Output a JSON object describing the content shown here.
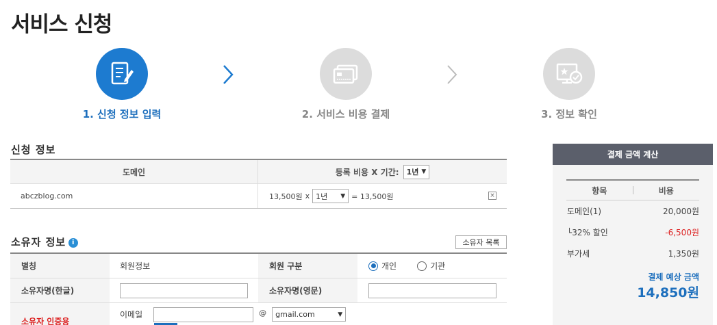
{
  "page": {
    "title": "서비스 신청"
  },
  "steps": [
    {
      "label": "1. 신청 정보 입력",
      "icon": "form-edit-icon",
      "active": true
    },
    {
      "label": "2. 서비스 비용 결제",
      "icon": "credit-card-icon",
      "active": false
    },
    {
      "label": "3. 정보 확인",
      "icon": "monitor-check-icon",
      "active": false
    }
  ],
  "application": {
    "section_title": "신청 정보",
    "col_domain": "도메인",
    "col_fee_prefix": "등록 비용 X 기간:",
    "period_select": "1년",
    "row": {
      "domain": "abczblog.com",
      "price": "13,500원",
      "times": "x",
      "period": "1년",
      "result": "= 13,500원",
      "remove": "×"
    }
  },
  "owner": {
    "section_title": "소유자 정보",
    "info_icon": "i",
    "list_button": "소유자 목록",
    "nickname_label": "별칭",
    "nickname_value": "회원정보",
    "member_type_label": "회원 구분",
    "member_type_options": [
      "개인",
      "기관"
    ],
    "member_type_selected": "개인",
    "name_kr_label": "소유자명(한글)",
    "name_en_label": "소유자명(영문)",
    "cert_label": "소유자 인증용",
    "email_label": "이메일",
    "email_at": "@",
    "email_domain": "gmail.com"
  },
  "summary": {
    "title": "결제 금액 계산",
    "col_item": "항목",
    "col_cost": "비용",
    "rows": [
      {
        "name": "도메인(1)",
        "value": "20,000원"
      },
      {
        "name": "└32% 할인",
        "value": "-6,500원"
      },
      {
        "name": "부가세",
        "value": "1,350원"
      }
    ],
    "total_label": "결제 예상 금액",
    "total_value": "14,850원"
  }
}
